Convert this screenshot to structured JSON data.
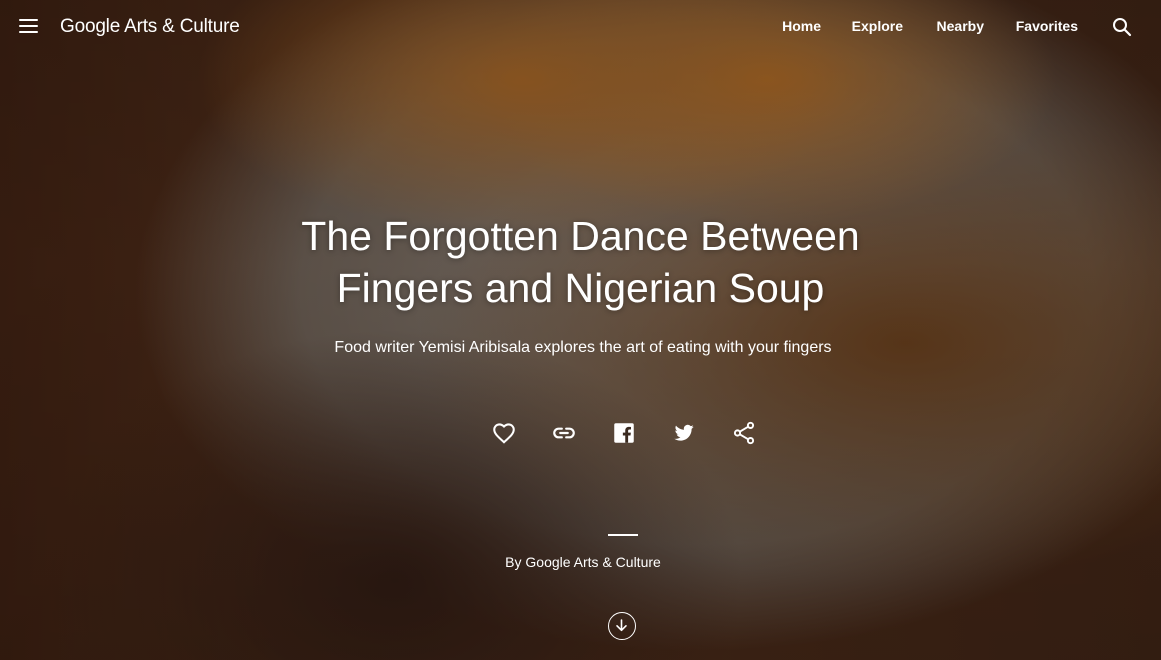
{
  "header": {
    "logo_google": "Google",
    "logo_rest": " Arts & Culture",
    "nav": [
      "Home",
      "Explore",
      "Nearby",
      "Favorites"
    ]
  },
  "icons": {
    "menu": "hamburger-menu-icon",
    "search": "search-icon",
    "favorite": "heart-icon",
    "link": "link-icon",
    "facebook": "facebook-icon",
    "twitter": "twitter-icon",
    "share": "share-icon",
    "scroll": "arrow-down-circle-icon"
  },
  "hero": {
    "title_line1": "The Forgotten Dance Between",
    "title_line2": "Fingers and Nigerian Soup",
    "subtitle": "Food writer Yemisi Aribisala explores the art of eating with your fingers",
    "byline": "By Google Arts & Culture"
  }
}
